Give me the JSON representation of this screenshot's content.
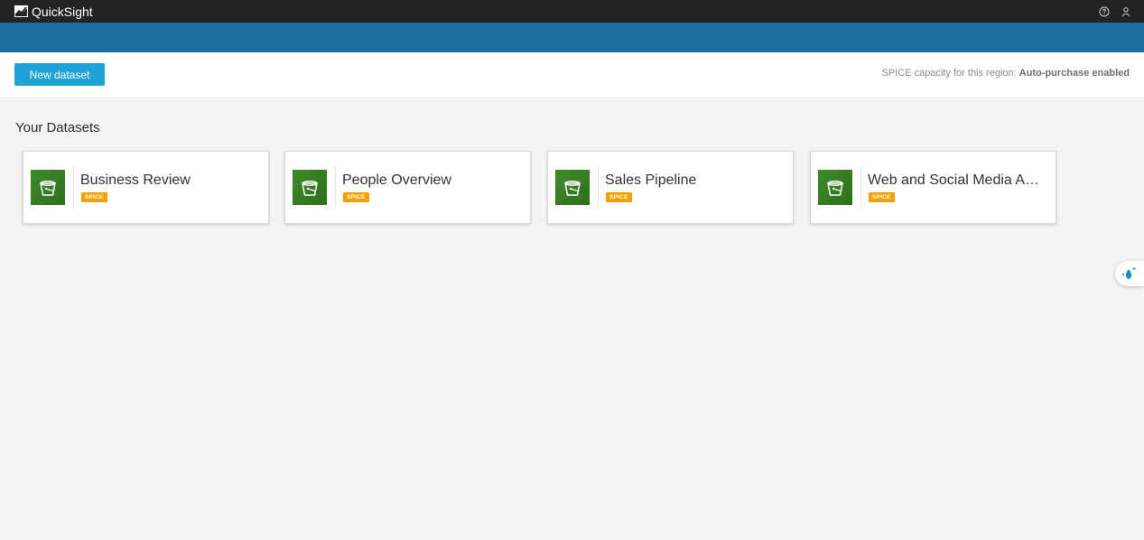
{
  "app": {
    "name": "QuickSight"
  },
  "actions": {
    "new_dataset_label": "New dataset",
    "capacity_prefix": "SPICE capacity for this region: ",
    "capacity_value": "Auto-purchase enabled"
  },
  "section": {
    "title": "Your Datasets"
  },
  "datasets": [
    {
      "name": "Business Review",
      "badge": "SPICE"
    },
    {
      "name": "People Overview",
      "badge": "SPICE"
    },
    {
      "name": "Sales Pipeline",
      "badge": "SPICE"
    },
    {
      "name": "Web and Social Media A…",
      "badge": "SPICE"
    }
  ],
  "icons": {
    "logo": "quicksight-logo-icon",
    "help": "help-icon",
    "user": "user-icon",
    "dataset": "s3-bucket-icon",
    "assistant": "assistant-sparkle-icon"
  },
  "colors": {
    "topbar": "#232323",
    "subbar": "#1a6f9e",
    "primary_button": "#1ea2d8",
    "spice_badge": "#f2a200",
    "dataset_icon": "#3f8a2b"
  }
}
